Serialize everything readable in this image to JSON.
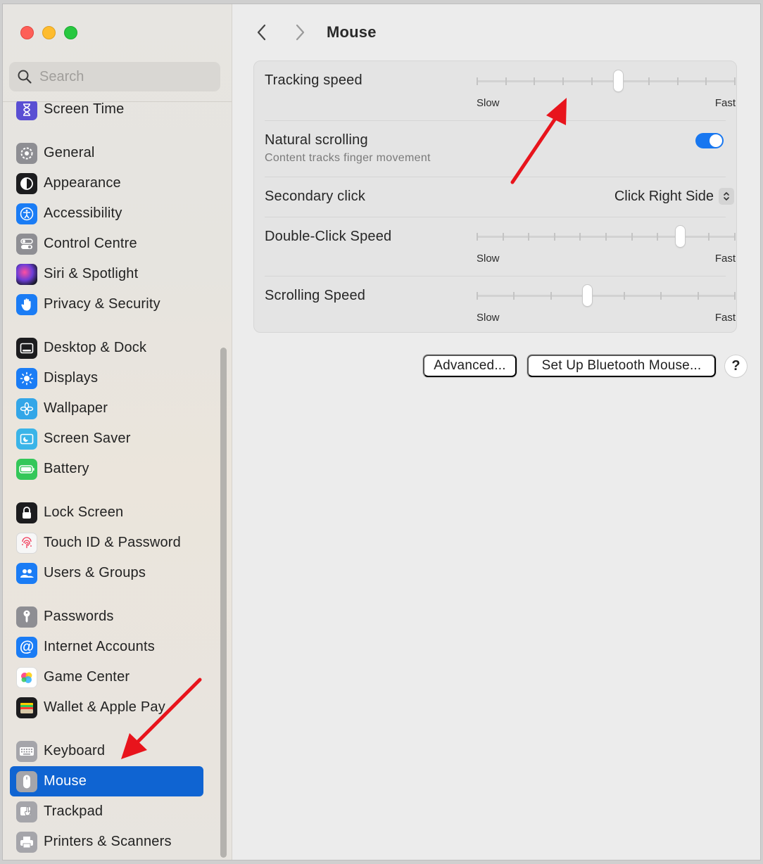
{
  "window": {
    "title": "Mouse"
  },
  "sidebar": {
    "search_placeholder": "Search",
    "items": [
      {
        "label": "Screen Time",
        "icon": "hourglass-icon",
        "color": "#5a4fd3"
      },
      {
        "label": "General",
        "icon": "gear-icon",
        "color": "#8e8e93"
      },
      {
        "label": "Appearance",
        "icon": "appearance-icon",
        "color": "#1c1c1e"
      },
      {
        "label": "Accessibility",
        "icon": "accessibility-icon",
        "color": "#1a7cf5"
      },
      {
        "label": "Control Centre",
        "icon": "control-centre-icon",
        "color": "#8e8e93"
      },
      {
        "label": "Siri & Spotlight",
        "icon": "siri-icon",
        "color": "#6b3dd6"
      },
      {
        "label": "Privacy & Security",
        "icon": "hand-icon",
        "color": "#1a7cf5"
      },
      {
        "label": "Desktop & Dock",
        "icon": "dock-icon",
        "color": "#1c1c1e"
      },
      {
        "label": "Displays",
        "icon": "sun-icon",
        "color": "#1a7cf5"
      },
      {
        "label": "Wallpaper",
        "icon": "flower-icon",
        "color": "#33a6e8"
      },
      {
        "label": "Screen Saver",
        "icon": "screen-saver-icon",
        "color": "#3ab4e8"
      },
      {
        "label": "Battery",
        "icon": "battery-icon",
        "color": "#34c759"
      },
      {
        "label": "Lock Screen",
        "icon": "lock-icon",
        "color": "#1c1c1e"
      },
      {
        "label": "Touch ID & Password",
        "icon": "fingerprint-icon",
        "color": "#f2f2f2"
      },
      {
        "label": "Users & Groups",
        "icon": "users-icon",
        "color": "#1a7cf5"
      },
      {
        "label": "Passwords",
        "icon": "key-icon",
        "color": "#8e8e93"
      },
      {
        "label": "Internet Accounts",
        "icon": "at-icon",
        "color": "#1a7cf5"
      },
      {
        "label": "Game Center",
        "icon": "game-center-icon",
        "color": "#ffffff"
      },
      {
        "label": "Wallet & Apple Pay",
        "icon": "wallet-icon",
        "color": "#1c1c1e"
      },
      {
        "label": "Keyboard",
        "icon": "keyboard-icon",
        "color": "#8e8e93"
      },
      {
        "label": "Mouse",
        "icon": "mouse-icon",
        "color": "#8e8e93",
        "selected": true
      },
      {
        "label": "Trackpad",
        "icon": "trackpad-icon",
        "color": "#8e8e93"
      },
      {
        "label": "Printers & Scanners",
        "icon": "printer-icon",
        "color": "#8e8e93"
      }
    ]
  },
  "main": {
    "title": "Mouse",
    "settings": {
      "tracking_speed": {
        "label": "Tracking speed",
        "min_label": "Slow",
        "max_label": "Fast",
        "ticks": 10,
        "value_fraction": 0.55
      },
      "natural_scrolling": {
        "label": "Natural scrolling",
        "description": "Content tracks finger movement",
        "enabled": true
      },
      "secondary_click": {
        "label": "Secondary click",
        "value": "Click Right Side"
      },
      "double_click_speed": {
        "label": "Double-Click Speed",
        "min_label": "Slow",
        "max_label": "Fast",
        "ticks": 11,
        "value_fraction": 0.79
      },
      "scrolling_speed": {
        "label": "Scrolling Speed",
        "min_label": "Slow",
        "max_label": "Fast",
        "ticks": 8,
        "value_fraction": 0.43
      }
    },
    "buttons": {
      "advanced": "Advanced...",
      "bluetooth": "Set Up Bluetooth Mouse...",
      "help": "?"
    }
  },
  "colors": {
    "accent": "#0f64d2",
    "toggle_on": "#1877f0",
    "annotation": "#e8141c"
  }
}
